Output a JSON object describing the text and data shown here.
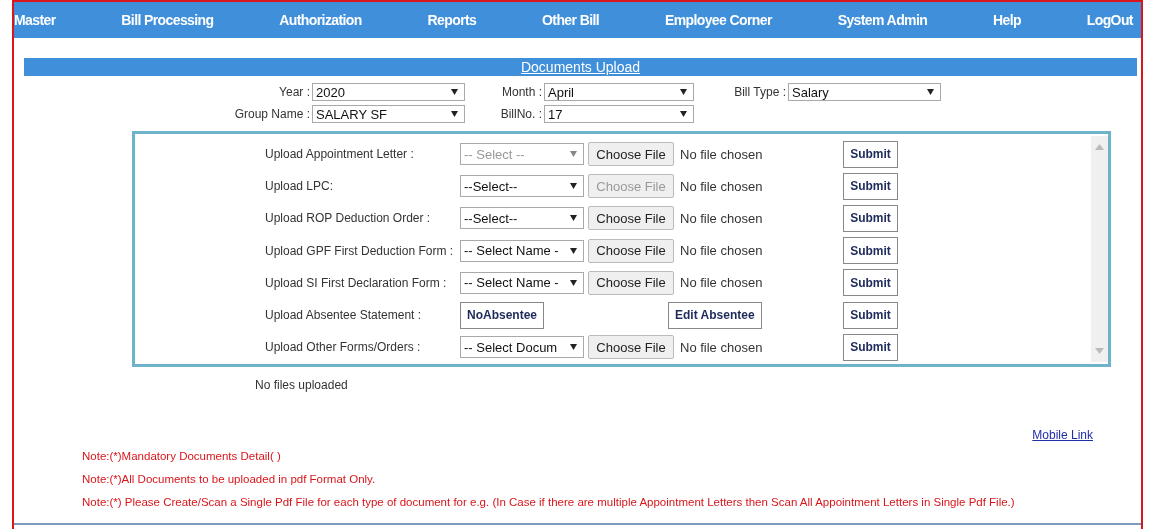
{
  "nav": [
    {
      "label": "Master"
    },
    {
      "label": "Bill Processing"
    },
    {
      "label": "Authorization"
    },
    {
      "label": "Reports"
    },
    {
      "label": "Other Bill"
    },
    {
      "label": "Employee Corner"
    },
    {
      "label": "System Admin"
    },
    {
      "label": "Help"
    },
    {
      "label": "LogOut"
    }
  ],
  "title": "Documents Upload",
  "filter_rows": [
    [
      {
        "label": "Year :",
        "value": "2020"
      },
      {
        "label": "Month :",
        "value": "April"
      },
      {
        "label": "Bill Type :",
        "value": "Salary"
      }
    ],
    [
      {
        "label": "Group Name :",
        "value": "SALARY SF"
      },
      {
        "label": "BillNo. :",
        "value": "17"
      }
    ]
  ],
  "upload_rows": [
    {
      "kind": "file",
      "label": "Upload Appointment Letter :",
      "select": "-- Select --",
      "select_disabled": true,
      "file_button": "Choose File",
      "file_disabled": false,
      "file_status": "No file chosen",
      "submit": "Submit"
    },
    {
      "kind": "file",
      "label": "Upload LPC:",
      "select": "--Select--",
      "select_disabled": false,
      "file_button": "Choose File",
      "file_disabled": true,
      "file_status": "No file chosen",
      "submit": "Submit"
    },
    {
      "kind": "file",
      "label": "Upload ROP Deduction Order :",
      "select": "--Select--",
      "select_disabled": false,
      "file_button": "Choose File",
      "file_disabled": false,
      "file_status": "No file chosen",
      "submit": "Submit"
    },
    {
      "kind": "file",
      "label": "Upload GPF First Deduction Form :",
      "select": "-- Select Name -",
      "select_disabled": false,
      "file_button": "Choose File",
      "file_disabled": false,
      "file_status": "No file chosen",
      "submit": "Submit"
    },
    {
      "kind": "file",
      "label": "Upload SI First Declaration Form :",
      "select": "-- Select Name -",
      "select_disabled": false,
      "file_button": "Choose File",
      "file_disabled": false,
      "file_status": "No file chosen",
      "submit": "Submit"
    },
    {
      "kind": "absentee",
      "label": "Upload Absentee Statement :",
      "no_button": "NoAbsentee",
      "edit_button": "Edit Absentee",
      "submit": "Submit"
    },
    {
      "kind": "file",
      "label": "Upload Other Forms/Orders :",
      "select": "-- Select Docum",
      "select_disabled": false,
      "file_button": "Choose File",
      "file_disabled": false,
      "file_status": "No file chosen",
      "submit": "Submit"
    }
  ],
  "uploaded_status": "No files uploaded",
  "mobile_link": "Mobile Link",
  "notes": [
    "Note:(*)Mandatory Documents Detail( )",
    "Note:(*)All Documents to be uploaded in pdf Format Only.",
    "Note:(*) Please Create/Scan a Single Pdf File for each type of document for e.g. (In Case if there are multiple Appointment Letters then Scan All Appointment Letters in Single Pdf File.)"
  ]
}
